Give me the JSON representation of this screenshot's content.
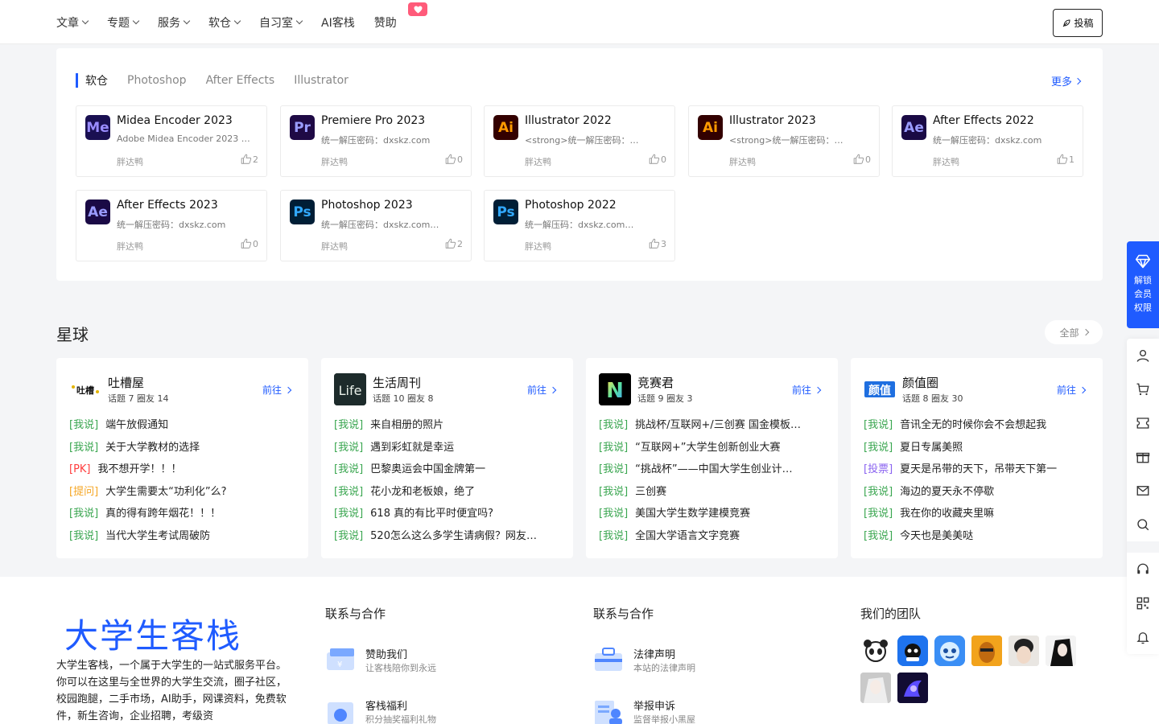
{
  "nav": {
    "items": [
      {
        "label": "文章",
        "dropdown": true
      },
      {
        "label": "专题",
        "dropdown": true
      },
      {
        "label": "服务",
        "dropdown": true
      },
      {
        "label": "软仓",
        "dropdown": true
      },
      {
        "label": "自习室",
        "dropdown": true
      },
      {
        "label": "AI客栈",
        "dropdown": false
      },
      {
        "label": "赞助",
        "dropdown": false
      }
    ],
    "badge_icon": "heart-icon",
    "submit_label": "投稿"
  },
  "software": {
    "tabs": [
      "软仓",
      "Photoshop",
      "After Effects",
      "Illustrator"
    ],
    "more_label": "更多",
    "cards": [
      {
        "icon": "Me",
        "icon_bg": "#1a1052",
        "icon_fg": "#9a8cff",
        "title": "Midea Encoder 2023",
        "desc": "Adobe Midea Encoder 2023 …",
        "author": "胖达鸭",
        "likes": "2"
      },
      {
        "icon": "Pr",
        "icon_bg": "#1f0a45",
        "icon_fg": "#9a9cff",
        "title": "Premiere Pro 2023",
        "desc": "统一解压密码：dxskz.com",
        "author": "胖达鸭",
        "likes": "0"
      },
      {
        "icon": "Ai",
        "icon_bg": "#330000",
        "icon_fg": "#ff9a00",
        "title": "Illustrator 2022",
        "desc": "<strong>统一解压密码：…",
        "author": "胖达鸭",
        "likes": "0"
      },
      {
        "icon": "Ai",
        "icon_bg": "#330000",
        "icon_fg": "#ff9a00",
        "title": "Illustrator 2023",
        "desc": "<strong>统一解压密码：…",
        "author": "胖达鸭",
        "likes": "0"
      },
      {
        "icon": "Ae",
        "icon_bg": "#1a0a45",
        "icon_fg": "#9a9cff",
        "title": "After Effects 2022",
        "desc": "统一解压密码：dxskz.com",
        "author": "胖达鸭",
        "likes": "1"
      },
      {
        "icon": "Ae",
        "icon_bg": "#1a0a45",
        "icon_fg": "#9a9cff",
        "title": "After Effects 2023",
        "desc": "统一解压密码：dxskz.com",
        "author": "胖达鸭",
        "likes": "0"
      },
      {
        "icon": "Ps",
        "icon_bg": "#001e36",
        "icon_fg": "#31a8ff",
        "title": "Photoshop 2023",
        "desc": "统一解压密码：dxskz.com…",
        "author": "胖达鸭",
        "likes": "2"
      },
      {
        "icon": "Ps",
        "icon_bg": "#001e36",
        "icon_fg": "#31a8ff",
        "title": "Photoshop 2022",
        "desc": "统一解压码：dxskz.com…",
        "author": "胖达鸭",
        "likes": "3"
      }
    ]
  },
  "planet": {
    "title": "星球",
    "all_label": "全部",
    "goto_label": "前往",
    "circles": [
      {
        "name": "吐槽屋",
        "meta": "话题 7   圈友 14",
        "logo_text": "吐槽",
        "posts": [
          {
            "tag": "[我说]",
            "type": "say",
            "text": "端午放假通知"
          },
          {
            "tag": "[我说]",
            "type": "say",
            "text": "关于大学教材的选择"
          },
          {
            "tag": "[PK]",
            "type": "pk",
            "text": "我不想开学！！！"
          },
          {
            "tag": "[提问]",
            "type": "ask",
            "text": "大学生需要太“功利化”么?"
          },
          {
            "tag": "[我说]",
            "type": "say",
            "text": "真的得有跨年烟花！！！"
          },
          {
            "tag": "[我说]",
            "type": "say",
            "text": "当代大学生考试周破防"
          }
        ]
      },
      {
        "name": "生活周刊",
        "meta": "话题 10   圈友 8",
        "logo_text": "Life",
        "posts": [
          {
            "tag": "[我说]",
            "type": "say",
            "text": "来自相册的照片"
          },
          {
            "tag": "[我说]",
            "type": "say",
            "text": "遇到彩虹就是幸运"
          },
          {
            "tag": "[我说]",
            "type": "say",
            "text": "巴黎奥运会中国金牌第一"
          },
          {
            "tag": "[我说]",
            "type": "say",
            "text": "花小龙和老板娘，绝了"
          },
          {
            "tag": "[我说]",
            "type": "say",
            "text": "618 真的有比平时便宜吗?"
          },
          {
            "tag": "[我说]",
            "type": "say",
            "text": "520怎么这么多学生请病假？网友…"
          }
        ]
      },
      {
        "name": "竞赛君",
        "meta": "话题 9   圈友 3",
        "logo_text": "N",
        "posts": [
          {
            "tag": "[我说]",
            "type": "say",
            "text": "挑战杯/互联网+/三创赛 国金模板…"
          },
          {
            "tag": "[我说]",
            "type": "say",
            "text": "“互联网+”大学生创新创业大赛"
          },
          {
            "tag": "[我说]",
            "type": "say",
            "text": "“挑战杯”——中国大学生创业计…"
          },
          {
            "tag": "[我说]",
            "type": "say",
            "text": "三创赛"
          },
          {
            "tag": "[我说]",
            "type": "say",
            "text": "美国大学生数学建模竞赛"
          },
          {
            "tag": "[我说]",
            "type": "say",
            "text": "全国大学语言文字竞赛"
          }
        ]
      },
      {
        "name": "颜值圈",
        "meta": "话题 8   圈友 30",
        "logo_text": "颜值",
        "posts": [
          {
            "tag": "[我说]",
            "type": "say",
            "text": "音讯全无的时候你会不会想起我"
          },
          {
            "tag": "[我说]",
            "type": "say",
            "text": "夏日专属美照"
          },
          {
            "tag": "[投票]",
            "type": "vote",
            "text": "夏天是吊带的天下，吊带天下第一"
          },
          {
            "tag": "[我说]",
            "type": "say",
            "text": "海边的夏天永不停歇"
          },
          {
            "tag": "[我说]",
            "type": "say",
            "text": "我在你的收藏夹里嘛"
          },
          {
            "tag": "[我说]",
            "type": "say",
            "text": "今天也是美美哒"
          }
        ]
      }
    ]
  },
  "footer": {
    "brand": "大学生客栈",
    "desc": "大学生客栈，一个属于大学生的一站式服务平台。你可以在这里与全世界的大学生交流，圈子社区，校园跑腿，二手市场，AI助手，网课资料，免费软件，新生咨询，企业招聘，考级资",
    "col1": {
      "title": "联系与合作",
      "items": [
        {
          "title": "赞助我们",
          "sub": "让客栈陪你到永远",
          "icon": "wallet-icon"
        },
        {
          "title": "客栈福利",
          "sub": "积分抽奖福利礼物",
          "icon": "gift-icon"
        }
      ]
    },
    "col2": {
      "title": "联系与合作",
      "items": [
        {
          "title": "法律声明",
          "sub": "本站的法律声明",
          "icon": "briefcase-icon"
        },
        {
          "title": "举报申诉",
          "sub": "监督举报小黑屋",
          "icon": "report-icon"
        }
      ]
    },
    "team_title": "我们的团队"
  },
  "side": {
    "vip_label": "解锁会员权限",
    "tools": [
      "user-icon",
      "cart-icon",
      "ticket-icon",
      "gift-icon",
      "mail-icon",
      "search-icon",
      "headset-icon",
      "qrcode-icon",
      "bell-icon"
    ]
  },
  "colors": {
    "accent": "#1f5bff",
    "say": "#3aa650",
    "pk": "#ff3c3c",
    "ask": "#f5a623",
    "vote": "#8a63f0"
  }
}
